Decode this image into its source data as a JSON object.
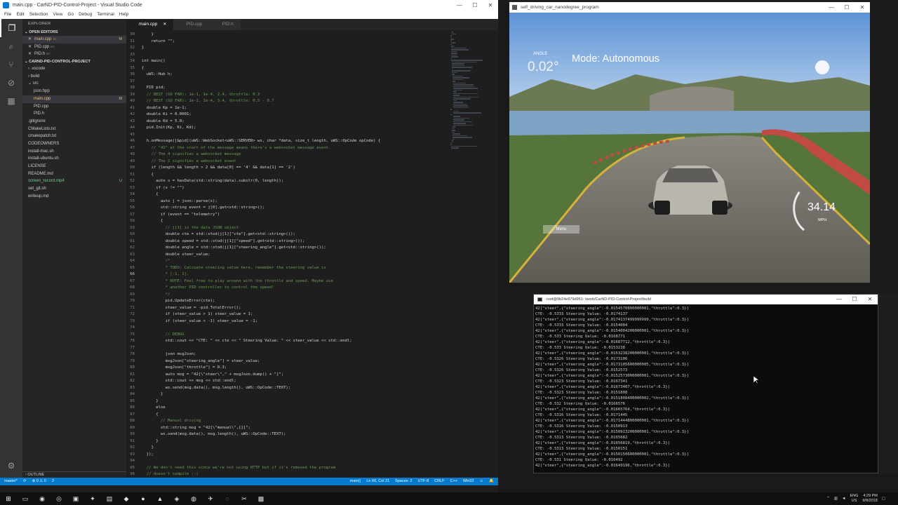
{
  "vscode": {
    "title": "main.cpp - CarND-PID-Control-Project - Visual Studio Code",
    "menu": [
      "File",
      "Edit",
      "Selection",
      "View",
      "Go",
      "Debug",
      "Terminal",
      "Help"
    ],
    "explorer_header": "EXPLORER",
    "open_editors_label": "OPEN EDITORS",
    "open_editors": [
      {
        "name": "main.cpp",
        "path": "src",
        "badge": "M"
      },
      {
        "name": "PID.cpp",
        "path": "src",
        "badge": ""
      },
      {
        "name": "PID.h",
        "path": "src",
        "badge": ""
      }
    ],
    "project_label": "CARND-PID-CONTROL-PROJECT",
    "files": [
      {
        "name": "› .vscode",
        "badge": ""
      },
      {
        "name": "› build",
        "badge": ""
      },
      {
        "name": "⌄ src",
        "badge": ""
      },
      {
        "name": "json.hpp",
        "badge": ""
      },
      {
        "name": "main.cpp",
        "badge": "M"
      },
      {
        "name": "PID.cpp",
        "badge": ""
      },
      {
        "name": "PID.h",
        "badge": ""
      },
      {
        "name": ".gitignore",
        "badge": ""
      },
      {
        "name": "CMakeLists.txt",
        "badge": ""
      },
      {
        "name": "cmakepatch.txt",
        "badge": ""
      },
      {
        "name": "CODEOWNERS",
        "badge": ""
      },
      {
        "name": "install-mac.sh",
        "badge": ""
      },
      {
        "name": "install-ubuntu.sh",
        "badge": ""
      },
      {
        "name": "LICENSE",
        "badge": ""
      },
      {
        "name": "README.md",
        "badge": ""
      },
      {
        "name": "screen_record.mp4",
        "badge": "U"
      },
      {
        "name": "set_git.sh",
        "badge": ""
      },
      {
        "name": "writeup.md",
        "badge": ""
      }
    ],
    "outline_label": "OUTLINE",
    "tabs": [
      {
        "label": "main.cpp",
        "active": true
      },
      {
        "label": "PID.cpp",
        "active": false
      },
      {
        "label": "PID.h",
        "active": false
      }
    ],
    "code_lines": [
      {
        "n": "30",
        "t": "    }"
      },
      {
        "n": "31",
        "t": "    return \"\";"
      },
      {
        "n": "32",
        "t": "}"
      },
      {
        "n": "33",
        "t": ""
      },
      {
        "n": "34",
        "t": "int main()"
      },
      {
        "n": "35",
        "t": "{"
      },
      {
        "n": "36",
        "t": "  uWS::Hub h;"
      },
      {
        "n": "37",
        "t": ""
      },
      {
        "n": "38",
        "t": "  PID pid;"
      },
      {
        "n": "39",
        "t": "  // BEST (SO FAR): 1e-1, 1e-4, 2.4, throttle: 0.3"
      },
      {
        "n": "40",
        "t": "  // BEST (SO FAR): 1e-1, 1e-4, 3.4, throttle: 0.5 - 0.7"
      },
      {
        "n": "41",
        "t": "  double Kp = 1e-1;"
      },
      {
        "n": "42",
        "t": "  double Ki = 0.0001;"
      },
      {
        "n": "43",
        "t": "  double Kd = 5.0;"
      },
      {
        "n": "44",
        "t": "  pid.Init(Kp, Ki, Kd);"
      },
      {
        "n": "45",
        "t": ""
      },
      {
        "n": "46",
        "t": "  h.onMessage([&pid](uWS::WebSocket<uWS::SERVER> ws, char *data, size_t length, uWS::OpCode opCode) {"
      },
      {
        "n": "47",
        "t": "    // \"42\" at the start of the message means there's a websocket message event."
      },
      {
        "n": "48",
        "t": "    // The 4 signifies a websocket message"
      },
      {
        "n": "49",
        "t": "    // The 2 signifies a websocket event"
      },
      {
        "n": "50",
        "t": "    if (length && length > 2 && data[0] == '4' && data[1] == '2')"
      },
      {
        "n": "51",
        "t": "    {"
      },
      {
        "n": "52",
        "t": "      auto s = hasData(std::string(data).substr(0, length));"
      },
      {
        "n": "53",
        "t": "      if (s != \"\")"
      },
      {
        "n": "54",
        "t": "      {"
      },
      {
        "n": "55",
        "t": "        auto j = json::parse(s);"
      },
      {
        "n": "56",
        "t": "        std::string event = j[0].get<std::string>();"
      },
      {
        "n": "57",
        "t": "        if (event == \"telemetry\")"
      },
      {
        "n": "58",
        "t": "        {"
      },
      {
        "n": "59",
        "t": "          // j[1] is the data JSON object"
      },
      {
        "n": "60",
        "t": "          double cte = std::stod(j[1][\"cte\"].get<std::string>());"
      },
      {
        "n": "61",
        "t": "          double speed = std::stod(j[1][\"speed\"].get<std::string>());"
      },
      {
        "n": "62",
        "t": "          double angle = std::stod(j[1][\"steering_angle\"].get<std::string>());"
      },
      {
        "n": "63",
        "t": "          double steer_value;"
      },
      {
        "n": "64",
        "t": "          /*"
      },
      {
        "n": "65",
        "t": "          * TODO: Calcuate steering value here, remember the steering value is"
      },
      {
        "n": "66",
        "t": "          * [-1, 1]."
      },
      {
        "n": "67",
        "t": "          * NOTE: Feel free to play around with the throttle and speed. Maybe use"
      },
      {
        "n": "68",
        "t": "          * another PID controller to control the speed!"
      },
      {
        "n": "69",
        "t": "          */"
      },
      {
        "n": "70",
        "t": "          pid.UpdateError(cte);"
      },
      {
        "n": "71",
        "t": "          steer_value = -pid.TotalError();"
      },
      {
        "n": "72",
        "t": "          if (steer_value > 1) steer_value = 1;"
      },
      {
        "n": "73",
        "t": "          if (steer_value < -1) steer_value = -1;"
      },
      {
        "n": "74",
        "t": ""
      },
      {
        "n": "75",
        "t": "          // DEBUG"
      },
      {
        "n": "76",
        "t": "          std::cout << \"CTE: \" << cte << \" Steering Value: \" << steer_value << std::endl;"
      },
      {
        "n": "77",
        "t": ""
      },
      {
        "n": "78",
        "t": "          json msgJson;"
      },
      {
        "n": "79",
        "t": "          msgJson[\"steering_angle\"] = steer_value;"
      },
      {
        "n": "80",
        "t": "          msgJson[\"throttle\"] = 0.3;"
      },
      {
        "n": "81",
        "t": "          auto msg = \"42[\\\"steer\\\",\" + msgJson.dump() + \"]\";"
      },
      {
        "n": "82",
        "t": "          std::cout << msg << std::endl;"
      },
      {
        "n": "83",
        "t": "          ws.send(msg.data(), msg.length(), uWS::OpCode::TEXT);"
      },
      {
        "n": "84",
        "t": "        }"
      },
      {
        "n": "85",
        "t": "      }"
      },
      {
        "n": "86",
        "t": "      else"
      },
      {
        "n": "87",
        "t": "      {"
      },
      {
        "n": "88",
        "t": "        // Manual driving"
      },
      {
        "n": "89",
        "t": "        std::string msg = \"42[\\\"manual\\\",{}]\";"
      },
      {
        "n": "90",
        "t": "        ws.send(msg.data(), msg.length(), uWS::OpCode::TEXT);"
      },
      {
        "n": "91",
        "t": "      }"
      },
      {
        "n": "92",
        "t": "    }"
      },
      {
        "n": "93",
        "t": "  });"
      },
      {
        "n": "94",
        "t": ""
      },
      {
        "n": "95",
        "t": "  // We don't need this since we're not using HTTP but if it's removed the program"
      },
      {
        "n": "96",
        "t": "  // doesn't compile :-("
      }
    ],
    "status": {
      "branch": "master*",
      "sync": "⟳",
      "problems": "⊗ 0 ⚠ 0",
      "changes": "2",
      "function": "main()",
      "position": "Ln 66, Col 21",
      "spaces": "Spaces: 2",
      "encoding": "UTF-8",
      "eol": "CRLF",
      "language": "C++",
      "platform": "Win32"
    }
  },
  "simulator": {
    "title": "self_driving_car_nanodegree_program",
    "angle_label": "ANGLE",
    "angle_value": "0.02°",
    "mode": "Mode: Autonomous",
    "speed": "34.14",
    "speed_unit": "MPH",
    "menu_button": "Menu"
  },
  "terminal": {
    "title": "root@9b24e979d951: /work/CarND-PID-Control-Project/build",
    "lines": [
      "42[\"steer\",{\"steering_angle\":-0.0154570800000001,\"throttle\":0.3}]",
      "CTE: -0.5333 Steering Value: -0.0174137",
      "42[\"steer\",{\"steering_angle\":-0.0174137499999999,\"throttle\":0.3}]",
      "CTE: -0.5333 Steering Value: -0.0154004",
      "42[\"steer\",{\"steering_angle\":-0.0154004200000001,\"throttle\":0.3}]",
      "CTE: -0.533 Steering Value: -0.0168771",
      "42[\"steer\",{\"steering_angle\":-0.01687712,\"throttle\":0.3}]",
      "CTE: -0.533 Steering Value: -0.0153238",
      "42[\"steer\",{\"steering_angle\":-0.0153238200000001,\"throttle\":0.3}]",
      "CTE: -0.5326 Steering Value: -0.0173106",
      "42[\"steer\",{\"steering_angle\":-0.0173105600000005,\"throttle\":0.3}]",
      "CTE: -0.5326 Steering Value: -0.0152573",
      "42[\"steer\",{\"steering_angle\":-0.0152573000000001,\"throttle\":0.3}]",
      "CTE: -0.5323 Steering Value: -0.0167341",
      "42[\"steer\",{\"steering_angle\":-0.01673407,\"throttle\":0.3}]",
      "CTE: -0.5323 Steering Value: -0.0151808",
      "42[\"steer\",{\"steering_angle\":-0.0151808400000002,\"throttle\":0.3}]",
      "CTE: -0.532 Steering Value: -0.0166576",
      "42[\"steer\",{\"steering_angle\":-0.01665764,\"throttle\":0.3}]",
      "CTE: -0.5316 Steering Value: -0.0171445",
      "42[\"steer\",{\"steering_angle\":-0.0171444800000001,\"throttle\":0.3}]",
      "CTE: -0.5316 Steering Value: -0.0150913",
      "42[\"steer\",{\"steering_angle\":-0.0150913200000001,\"throttle\":0.3}]",
      "CTE: -0.5313 Steering Value: -0.0165682",
      "42[\"steer\",{\"steering_angle\":-0.01656819,\"throttle\":0.3}]",
      "CTE: -0.5313 Steering Value: -0.0150151",
      "42[\"steer\",{\"steering_angle\":-0.0150150600000001,\"throttle\":0.3}]",
      "CTE: -0.531 Steering Value: -0.016492",
      "42[\"steer\",{\"steering_angle\":-0.01649196,\"throttle\":0.3}]"
    ]
  },
  "taskbar": {
    "time": "4:29 PM",
    "date": "9/8/2018",
    "lang_top": "ENG",
    "lang_bottom": "US"
  }
}
